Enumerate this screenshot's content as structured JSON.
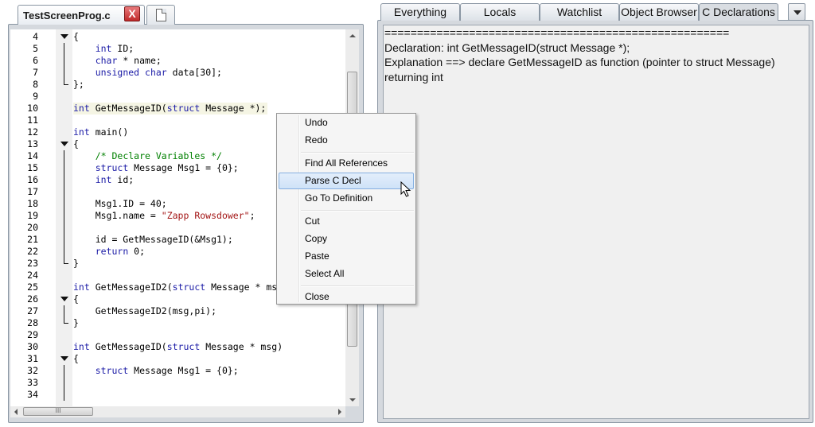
{
  "editor": {
    "file_tab": "TestScreenProg.c",
    "close_glyph": "X",
    "lines": [
      {
        "n": "4",
        "fold": "open",
        "html": "{"
      },
      {
        "n": "5",
        "fold": "mid",
        "html": "    <span class='kw'>int</span> ID;"
      },
      {
        "n": "6",
        "fold": "mid",
        "html": "    <span class='kw'>char</span> * name;"
      },
      {
        "n": "7",
        "fold": "mid",
        "html": "    <span class='kw'>unsigned</span> <span class='kw'>char</span> data[30];"
      },
      {
        "n": "8",
        "fold": "end",
        "html": "};"
      },
      {
        "n": "9",
        "fold": "",
        "html": ""
      },
      {
        "n": "10",
        "fold": "",
        "html": "<span class='kw'>int</span> GetMessageID(<span class='kw'>struct</span> Message *);",
        "hl": true
      },
      {
        "n": "11",
        "fold": "",
        "html": ""
      },
      {
        "n": "12",
        "fold": "",
        "html": "<span class='kw'>int</span> main()"
      },
      {
        "n": "13",
        "fold": "open",
        "html": "{"
      },
      {
        "n": "14",
        "fold": "mid",
        "html": "    <span class='cm'>/* Declare Variables */</span>"
      },
      {
        "n": "15",
        "fold": "mid",
        "html": "    <span class='kw'>struct</span> Message Msg1 = {0};"
      },
      {
        "n": "16",
        "fold": "mid",
        "html": "    <span class='kw'>int</span> id;"
      },
      {
        "n": "17",
        "fold": "mid",
        "html": ""
      },
      {
        "n": "18",
        "fold": "mid",
        "html": "    Msg1.ID = 40;"
      },
      {
        "n": "19",
        "fold": "mid",
        "html": "    Msg1.name = <span class='st'>\"Zapp Rowsdower\"</span>;"
      },
      {
        "n": "20",
        "fold": "mid",
        "html": ""
      },
      {
        "n": "21",
        "fold": "mid",
        "html": "    id = GetMessageID(&amp;Msg1);"
      },
      {
        "n": "22",
        "fold": "mid",
        "html": "    <span class='kw'>return</span> 0;"
      },
      {
        "n": "23",
        "fold": "end",
        "html": "}"
      },
      {
        "n": "24",
        "fold": "",
        "html": ""
      },
      {
        "n": "25",
        "fold": "",
        "html": "<span class='kw'>int</span> GetMessageID2(<span class='kw'>struct</span> Message * msg"
      },
      {
        "n": "26",
        "fold": "open",
        "html": "{"
      },
      {
        "n": "27",
        "fold": "mid",
        "html": "    GetMessageID2(msg,pi);"
      },
      {
        "n": "28",
        "fold": "end",
        "html": "}"
      },
      {
        "n": "29",
        "fold": "",
        "html": ""
      },
      {
        "n": "30",
        "fold": "",
        "html": "<span class='kw'>int</span> GetMessageID(<span class='kw'>struct</span> Message * msg)"
      },
      {
        "n": "31",
        "fold": "open",
        "html": "{"
      },
      {
        "n": "32",
        "fold": "mid",
        "html": "    <span class='kw'>struct</span> Message Msg1 = {0};"
      },
      {
        "n": "33",
        "fold": "mid",
        "html": ""
      },
      {
        "n": "34",
        "fold": "mid",
        "html": ""
      }
    ],
    "hscroll_grip": "III"
  },
  "right_panel": {
    "tabs": [
      {
        "label": "Everything",
        "active": false
      },
      {
        "label": "Locals",
        "active": false
      },
      {
        "label": "Watchlist",
        "active": false
      },
      {
        "label": "Object Browser",
        "active": false
      },
      {
        "label": "C Declarations",
        "active": true
      }
    ],
    "output": [
      "=====================================================",
      "Declaration: int GetMessageID(struct Message *);",
      "Explanation ==> declare GetMessageID as function (pointer to struct Message) returning int"
    ]
  },
  "context_menu": {
    "groups": [
      [
        "Undo",
        "Redo"
      ],
      [
        "Find All References",
        "Parse C Decl",
        "Go To Definition"
      ],
      [
        "Cut",
        "Copy",
        "Paste",
        "Select All"
      ],
      [
        "Close"
      ]
    ],
    "highlighted": "Parse C Decl"
  }
}
